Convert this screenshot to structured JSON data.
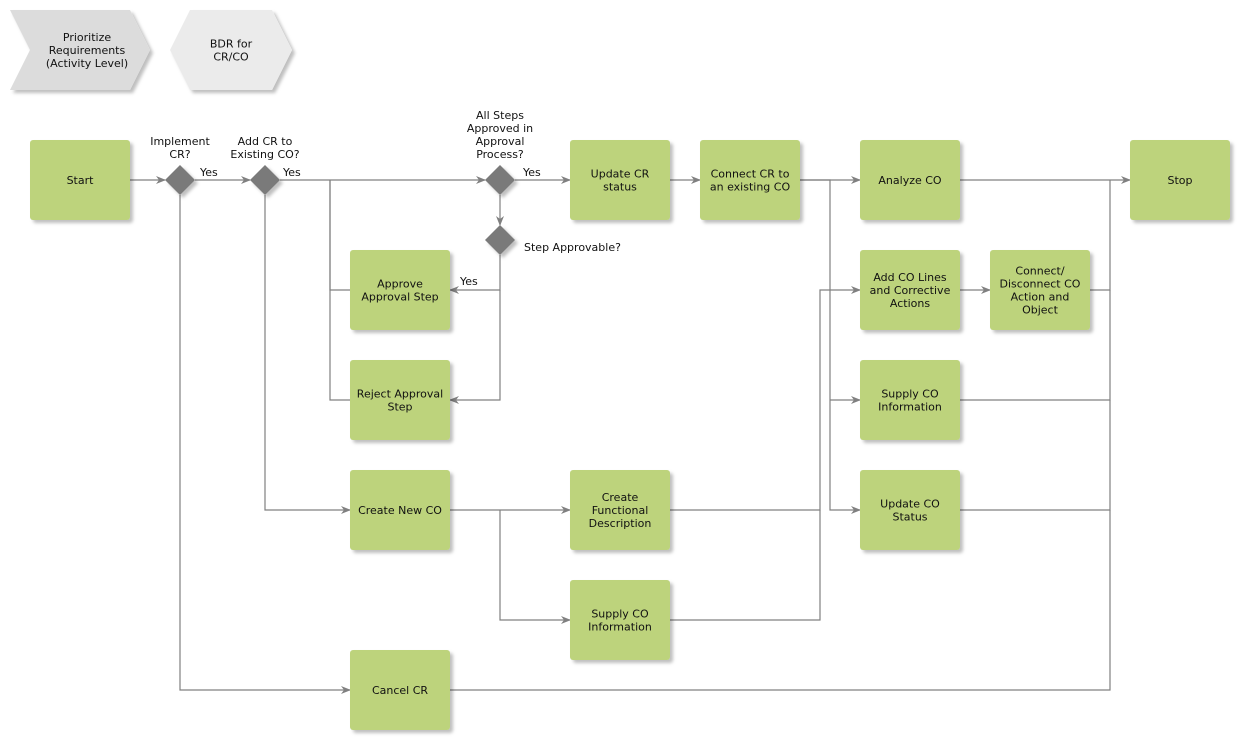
{
  "colors": {
    "activity": "#bdd37c",
    "decision": "#7a7a7a",
    "process_nav_1": "#dcdcdc",
    "process_nav_2": "#ebebeb",
    "connector": "#808080"
  },
  "process_links": [
    {
      "id": "nav1",
      "label": [
        "Prioritize",
        "Requirements",
        "(Activity Level)"
      ]
    },
    {
      "id": "nav2",
      "label": [
        "BDR for",
        "CR/CO"
      ]
    }
  ],
  "activities": [
    {
      "id": "start",
      "label": [
        "Start"
      ]
    },
    {
      "id": "update_cr",
      "label": [
        "Update CR",
        "status"
      ]
    },
    {
      "id": "connect_cr",
      "label": [
        "Connect CR to",
        "an existing CO"
      ]
    },
    {
      "id": "analyze",
      "label": [
        "Analyze CO"
      ]
    },
    {
      "id": "stop",
      "label": [
        "Stop"
      ]
    },
    {
      "id": "approve",
      "label": [
        "Approve",
        "Approval Step"
      ]
    },
    {
      "id": "reject",
      "label": [
        "Reject Approval",
        "Step"
      ]
    },
    {
      "id": "add_lines",
      "label": [
        "Add CO Lines",
        "and Corrective",
        "Actions"
      ]
    },
    {
      "id": "connect_disc",
      "label": [
        "Connect/",
        "Disconnect CO",
        "Action and",
        "Object"
      ]
    },
    {
      "id": "supply_r",
      "label": [
        "Supply CO",
        "Information"
      ]
    },
    {
      "id": "create_co",
      "label": [
        "Create New CO"
      ]
    },
    {
      "id": "func_desc",
      "label": [
        "Create",
        "Functional",
        "Description"
      ]
    },
    {
      "id": "update_co",
      "label": [
        "Update CO",
        "Status"
      ]
    },
    {
      "id": "supply_b",
      "label": [
        "Supply CO",
        "Information"
      ]
    },
    {
      "id": "cancel",
      "label": [
        "Cancel CR"
      ]
    }
  ],
  "decisions": [
    {
      "id": "d1",
      "label": [
        "Implement",
        "CR?"
      ]
    },
    {
      "id": "d2",
      "label": [
        "Add CR to",
        "Existing CO?"
      ]
    },
    {
      "id": "d3",
      "label": [
        "All Steps",
        "Approved in",
        "Approval",
        "Process?"
      ]
    },
    {
      "id": "d4",
      "label": [
        "Step Approvable?"
      ]
    }
  ],
  "edge_labels": [
    "Yes",
    "Yes",
    "Yes",
    "Yes"
  ]
}
